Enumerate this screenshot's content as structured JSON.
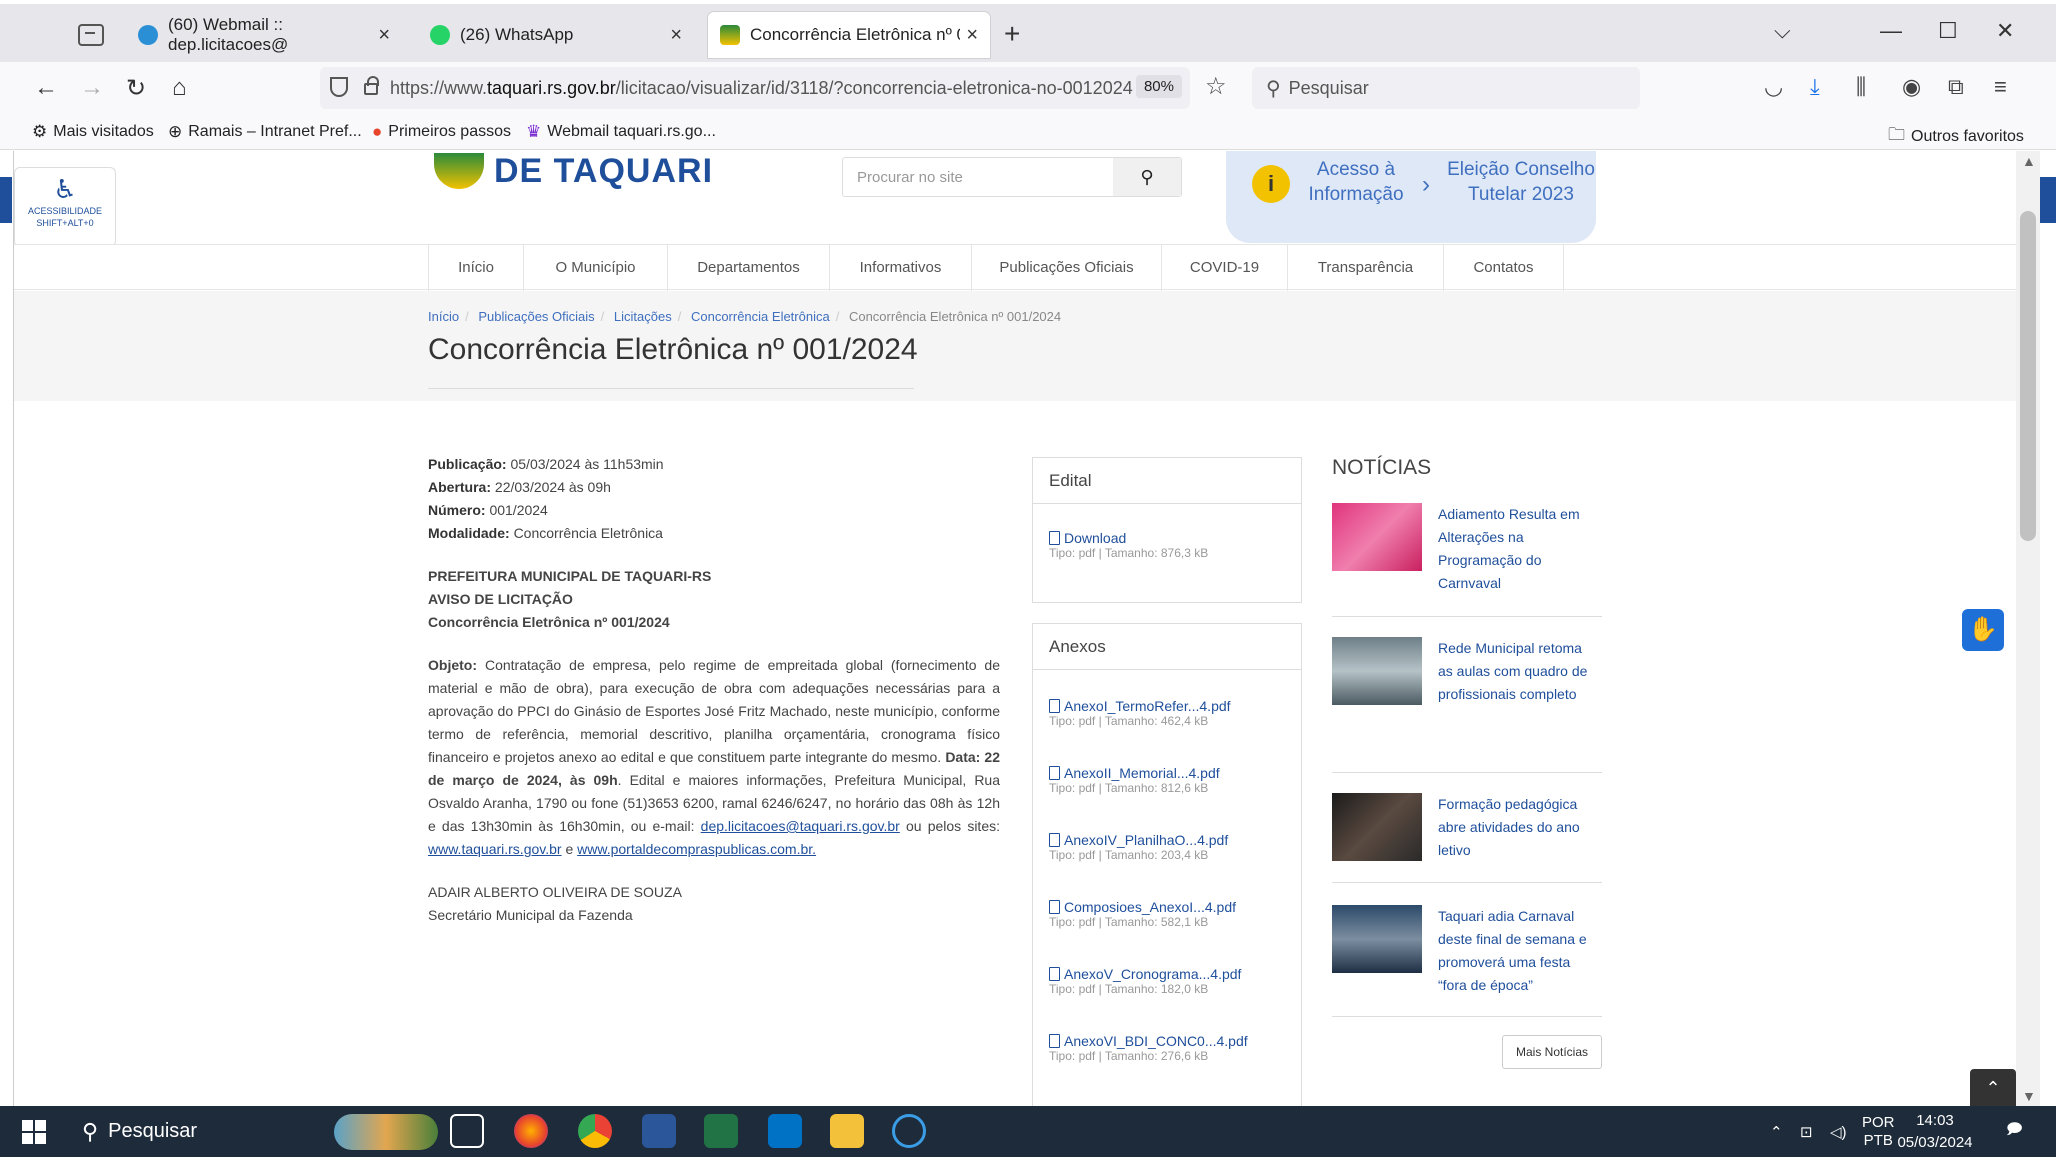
{
  "browser": {
    "tabs": [
      {
        "label": "(60) Webmail :: dep.licitacoes@",
        "close": "×"
      },
      {
        "label": "(26) WhatsApp",
        "close": "×"
      },
      {
        "label": "Concorrência Eletrônica nº 001/",
        "close": "×"
      }
    ],
    "new_tab": "+",
    "url_prefix": "https://www.",
    "url_domain": "taquari.rs.gov.br",
    "url_rest": "/licitacao/visualizar/id/3118/?concorrencia-eletronica-no-0012024",
    "zoom": "80%",
    "search_placeholder": "Pesquisar",
    "bookmarks": [
      "Mais visitados",
      "Ramais – Intranet Pref...",
      "Primeiros passos",
      "Webmail taquari.rs.go..."
    ],
    "other_bookmarks": "Outros favoritos"
  },
  "site": {
    "accessibility": {
      "line1": "ACESSIBILIDADE",
      "line2": "SHIFT+ALT+0"
    },
    "logo_text": "DE TAQUARI",
    "search_placeholder": "Procurar no site",
    "promo": {
      "left": "Acesso à Informação",
      "right": "Eleição Conselho Tutelar 2023"
    },
    "nav": [
      "Início",
      "O Município",
      "Departamentos",
      "Informativos",
      "Publicações Oficiais",
      "COVID-19",
      "Transparência",
      "Contatos"
    ],
    "breadcrumb": [
      "Início",
      "Publicações Oficiais",
      "Licitações",
      "Concorrência Eletrônica",
      "Concorrência Eletrônica nº 001/2024"
    ],
    "title": "Concorrência Eletrônica nº 001/2024"
  },
  "details": {
    "pub_label": "Publicação:",
    "pub_value": "05/03/2024 às 11h53min",
    "abe_label": "Abertura:",
    "abe_value": "22/03/2024 às 09h",
    "num_label": "Número:",
    "num_value": "001/2024",
    "mod_label": "Modalidade:",
    "mod_value": "Concorrência Eletrônica",
    "head1": "PREFEITURA MUNICIPAL DE TAQUARI-RS",
    "head2": "AVISO DE LICITAÇÃO",
    "head3": "Concorrência Eletrônica nº 001/2024",
    "obj_label": "Objeto:",
    "obj_text": "Contratação de empresa, pelo regime de empreitada global (fornecimento de material e mão de obra), para execução de obra com adequações necessárias para a aprovação do PPCI do Ginásio de Esportes José Fritz Machado, neste município, conforme termo de referência, memorial descritivo, planilha orçamentária, cronograma físico financeiro e projetos anexo ao edital e que constituem parte integrante do mesmo.",
    "date_bold": "Data: 22 de março de 2024, às 09h",
    "more_text": ". Edital e maiores informações, Prefeitura Municipal, Rua Osvaldo Aranha, 1790 ou fone (51)3653 6200, ramal 6246/6247, no horário das 08h às 12h e das 13h30min às 16h30min, ou e-mail:",
    "email": "dep.licitacoes@taquari.rs.gov.br",
    "sites_text": "ou pelos sites:",
    "site1": "www.taquari.rs.gov.br",
    "and_text": "e",
    "site2": "www.portaldecompraspublicas.com.br.",
    "signer": "ADAIR ALBERTO OLIVEIRA DE SOUZA",
    "signer_role": "Secretário Municipal da Fazenda"
  },
  "edital": {
    "header": "Edital",
    "file": {
      "name": "Download",
      "type": "Tipo: pdf",
      "size": "Tamanho: 876,3 kB"
    }
  },
  "anexos": {
    "header": "Anexos",
    "files": [
      {
        "name": "AnexoI_TermoRefer...4.pdf",
        "type": "Tipo: pdf",
        "size": "Tamanho: 462,4 kB"
      },
      {
        "name": "AnexoII_Memorial...4.pdf",
        "type": "Tipo: pdf",
        "size": "Tamanho: 812,6 kB"
      },
      {
        "name": "AnexoIV_PlanilhaO...4.pdf",
        "type": "Tipo: pdf",
        "size": "Tamanho: 203,4 kB"
      },
      {
        "name": "Composioes_AnexoI...4.pdf",
        "type": "Tipo: pdf",
        "size": "Tamanho: 582,1 kB"
      },
      {
        "name": "AnexoV_Cronograma...4.pdf",
        "type": "Tipo: pdf",
        "size": "Tamanho: 182,0 kB"
      },
      {
        "name": "AnexoVI_BDI_CONC0...4.pdf",
        "type": "Tipo: pdf",
        "size": "Tamanho: 276,6 kB"
      }
    ]
  },
  "news": {
    "header": "NOTÍCIAS",
    "items": [
      "Adiamento Resulta em Alterações na Programação do Carnvaval",
      "Rede Municipal retoma as aulas com quadro de profissionais completo",
      "Formação pedagógica abre atividades do ano letivo",
      "Taquari adia Carnaval deste final de semana e promoverá uma festa “fora de época”"
    ],
    "more": "Mais Notícias"
  },
  "taskbar": {
    "search": "Pesquisar",
    "lang1": "POR",
    "lang2": "PTB",
    "time": "14:03",
    "date": "05/03/2024"
  },
  "colors": {
    "brand_blue": "#1f4f9b",
    "link_blue": "#3f6fbf",
    "taskbar": "#1d2b3a"
  }
}
